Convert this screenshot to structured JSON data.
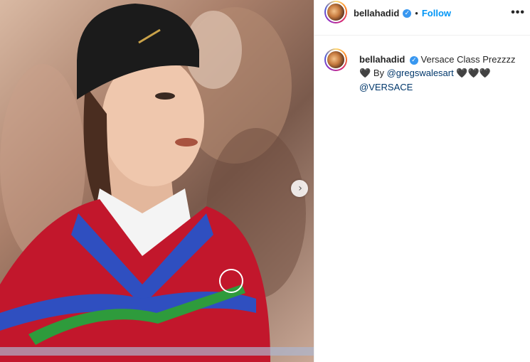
{
  "header": {
    "username": "bellahadid",
    "separator": "•",
    "follow_label": "Follow",
    "more_label": "•••"
  },
  "caption": {
    "username": "bellahadid",
    "text": "Versace Class Prezzzz",
    "heart1": "🖤",
    "by_label": "By",
    "mention1": "@gregswalesart",
    "hearts_after": "🖤🖤🖤",
    "mention2": "@VERSACE"
  },
  "icons": {
    "verified": "verified-badge-icon",
    "next": "chevron-right-icon"
  },
  "colors": {
    "follow": "#0095f6",
    "verified": "#3897f0",
    "link": "#00376b"
  }
}
